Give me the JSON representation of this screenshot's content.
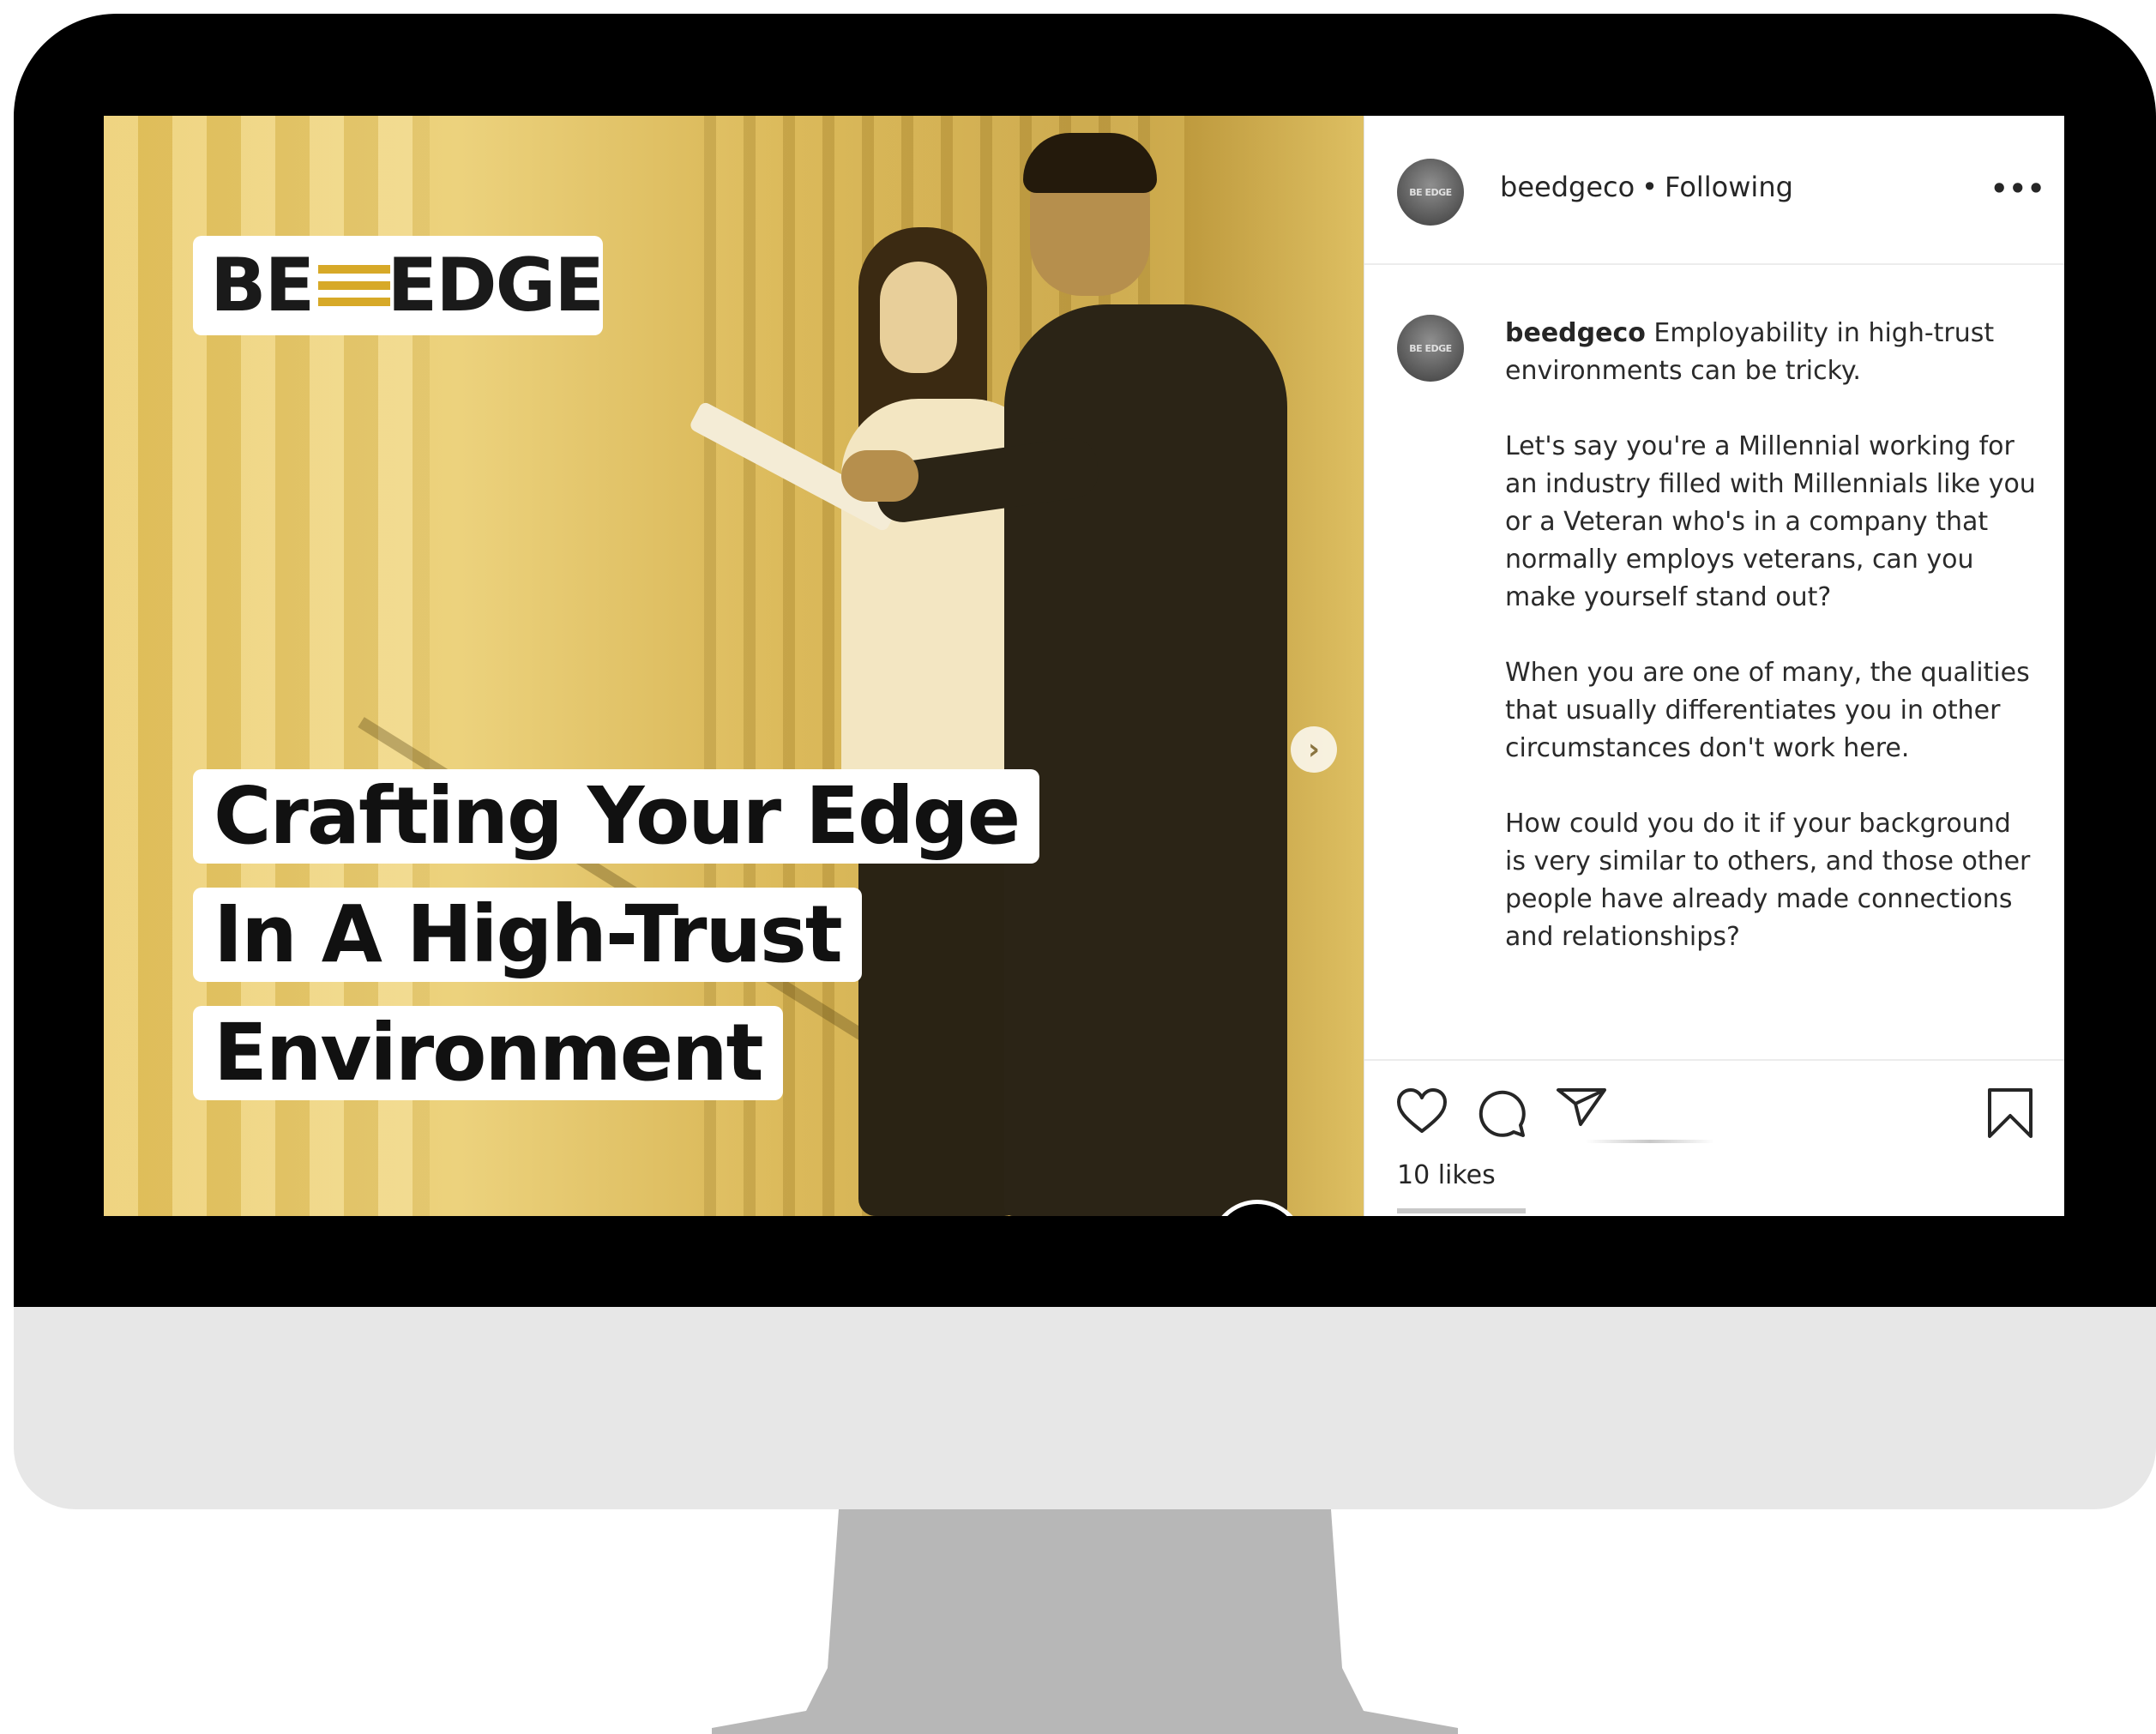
{
  "post_image": {
    "logo": {
      "left": "BE",
      "right": "EDGE",
      "accent_color": "#d7a928"
    },
    "headline": [
      "Crafting Your Edge",
      "In A High-Trust",
      "Environment"
    ],
    "next_arrow": "›"
  },
  "header": {
    "avatar_text": "BE EDGE",
    "username": "beedgeco",
    "separator": "•",
    "follow_status": "Following",
    "more": "•••"
  },
  "caption": {
    "username": "beedgeco",
    "paragraphs": [
      "Employability in high-trust environments can be tricky.",
      "Let's say you're a Millennial working for an industry filled with Millennials like you or a Veteran who's in a company that normally employs veterans, can you make yourself stand out?",
      "When you are one of many, the qualities that usually differentiates you in other circumstances don't work here.",
      "How could you do it if your background is very similar to others, and those other people have already made connections and relationships?"
    ]
  },
  "actions": {
    "icons": [
      "heart-icon",
      "comment-icon",
      "send-icon",
      "bookmark-icon"
    ],
    "likes": "10 likes"
  },
  "colors": {
    "bezel": "#000000",
    "chin": "#e7e7e7",
    "stand": "#b7b7b7",
    "image_tint": "#e6c560"
  }
}
